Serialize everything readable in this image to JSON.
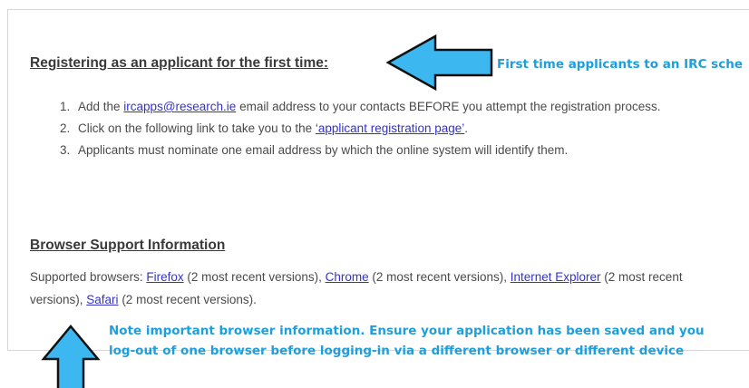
{
  "register": {
    "heading": "Registering as an applicant for the first time:",
    "steps": [
      {
        "num": "1.",
        "before": "Add the ",
        "link": "ircapps@research.ie",
        "after": "  email address to your contacts BEFORE you attempt the registration process."
      },
      {
        "num": "2.",
        "before": "Click on the following link to take you to the ",
        "link": "‘applicant registration page’",
        "after": "."
      },
      {
        "num": "3.",
        "text": "Applicants must nominate one email address by which the online system will identify them."
      }
    ]
  },
  "browser": {
    "heading": "Browser Support Information",
    "prefix": "Supported browsers: ",
    "firefox": "Firefox",
    "firefox_suffix": " (2 most recent versions), ",
    "chrome": "Chrome",
    "chrome_suffix": " (2 most recent versions), ",
    "ie": "Internet Explorer",
    "ie_suffix": " (2 most recent versions), ",
    "safari": "Safari",
    "safari_suffix": " (2 most recent versions)."
  },
  "annotations": {
    "first_time": "First time applicants to an IRC sche",
    "note_line1": "Note important browser information. Ensure your application has been saved and you",
    "note_line2": "log-out of one browser before logging-in via a different browser or different device"
  },
  "colors": {
    "arrow_fill": "#3db7f0",
    "callout_text": "#1e9fdc",
    "link": "#3333cc"
  },
  "icons": {
    "left_arrow": "arrow-left-icon",
    "up_arrow": "arrow-up-icon"
  }
}
